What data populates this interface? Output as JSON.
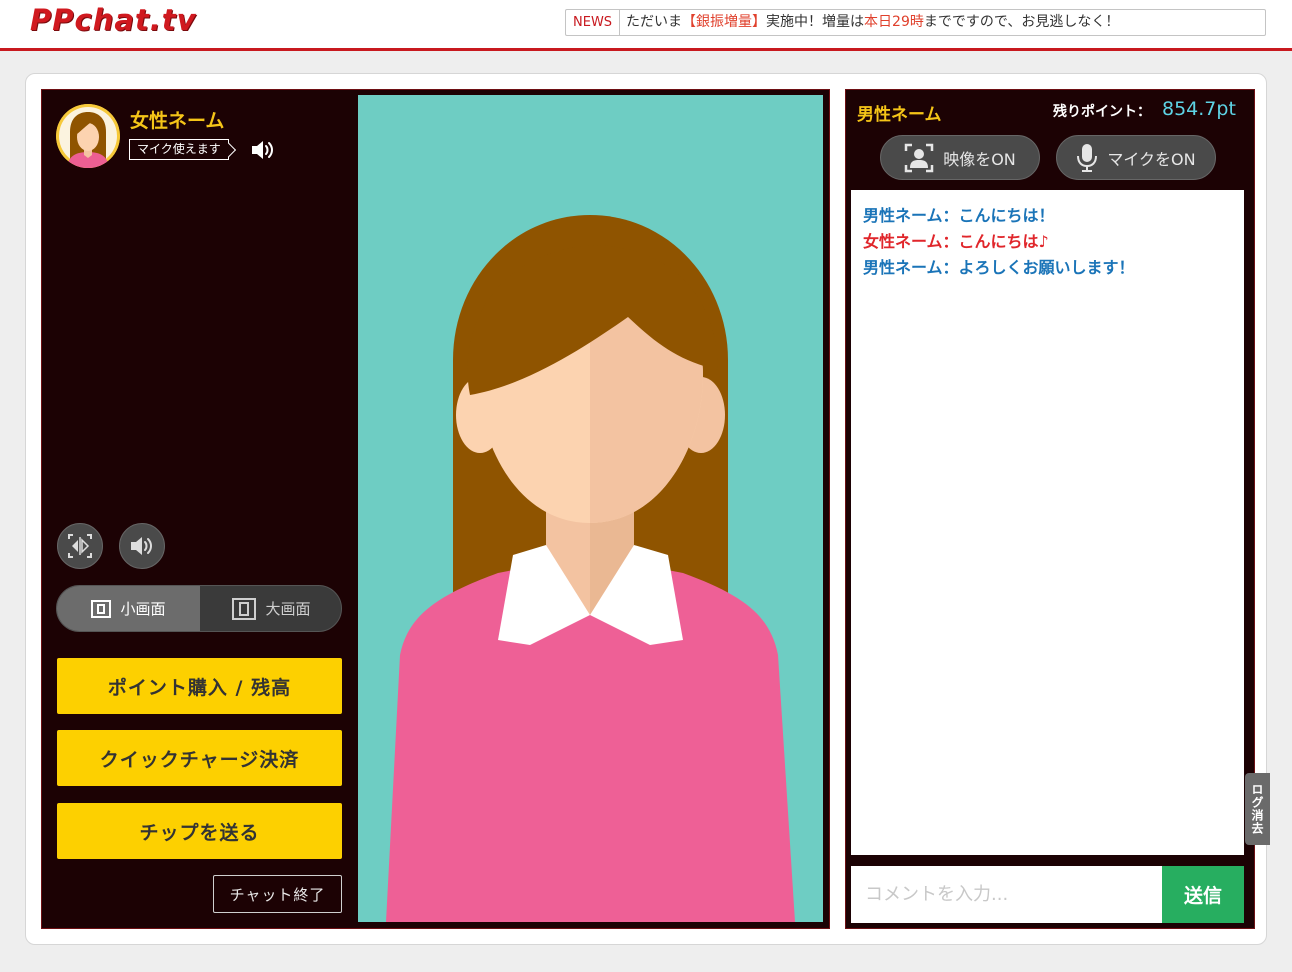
{
  "header": {
    "logo": "PPchat.tv",
    "news_tag": "NEWS",
    "news_before": "ただいま",
    "news_highlight1": "【銀振増量】",
    "news_middle": "実施中！増量は",
    "news_highlight2": "本日29時",
    "news_after": "までですので、お見逃しなく！"
  },
  "performer": {
    "name": "女性ネーム",
    "mic_badge": "マイク使えます",
    "avatar_icon": "woman-avatar-icon"
  },
  "controls": {
    "screen_small": "小画面",
    "screen_large": "大画面",
    "buy_points": "ポイント購入 / 残高",
    "quick_charge": "クイックチャージ決済",
    "send_tip": "チップを送る",
    "end_chat": "チャット終了"
  },
  "user": {
    "name": "男性ネーム",
    "points_label": "残りポイント：",
    "points_value": "854.7pt",
    "video_on": "映像をON",
    "mic_on": "マイクをON"
  },
  "chat": {
    "messages": [
      {
        "role": "male",
        "text": "男性ネーム：こんにちは！"
      },
      {
        "role": "female",
        "text": "女性ネーム：こんにちは♪"
      },
      {
        "role": "male",
        "text": "男性ネーム：よろしくお願いします！"
      }
    ],
    "log_clear": "ログ消去",
    "input_placeholder": "コメントを入力...",
    "send": "送信"
  },
  "colors": {
    "brand_red": "#c8191f",
    "panel_bg": "#1c0204",
    "yellow": "#fdd000",
    "video_bg": "#6ecdc3",
    "send_green": "#27ae60",
    "male_text": "#1a74b8",
    "female_text": "#e0262b"
  }
}
